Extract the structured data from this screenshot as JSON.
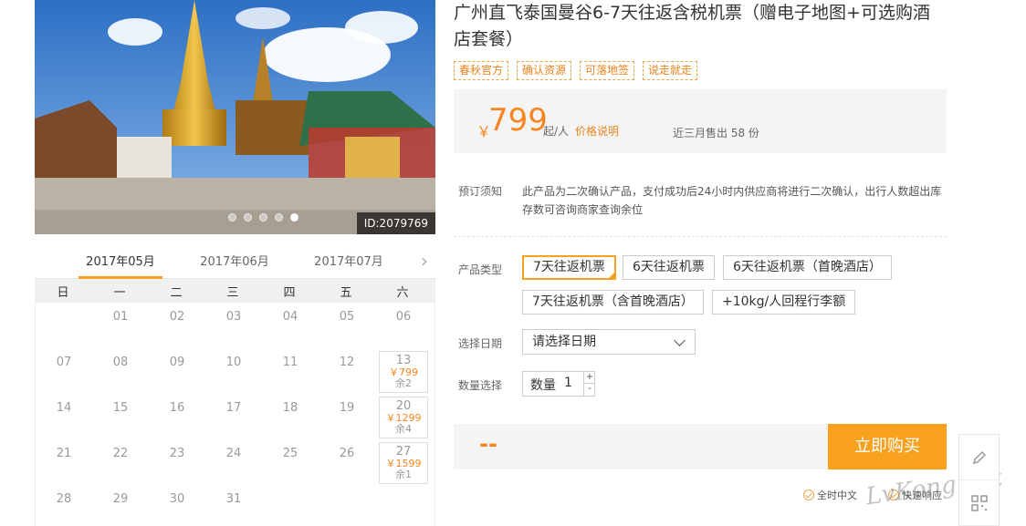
{
  "photo": {
    "id_label": "ID:2079769",
    "slides": 5,
    "active_slide": 5
  },
  "calendar": {
    "months": [
      "2017年05月",
      "2017年06月",
      "2017年07月"
    ],
    "active_month": 0,
    "weekdays": [
      "日",
      "一",
      "二",
      "三",
      "四",
      "五",
      "六"
    ],
    "leading_blanks": 1,
    "days": [
      "01",
      "02",
      "03",
      "04",
      "05",
      "06",
      "07",
      "08",
      "09",
      "10",
      "11",
      "12",
      "13",
      "14",
      "15",
      "16",
      "17",
      "18",
      "19",
      "20",
      "21",
      "22",
      "23",
      "24",
      "25",
      "26",
      "27",
      "28",
      "29",
      "30",
      "31"
    ],
    "available": {
      "13": {
        "price": "￥799",
        "left": "余2"
      },
      "20": {
        "price": "￥1299",
        "left": "余4"
      },
      "27": {
        "price": "￥1599",
        "left": "余1"
      }
    }
  },
  "product": {
    "title": "广州直飞泰国曼谷6-7天往返含税机票（赠电子地图+可选购酒店套餐）",
    "tags": [
      "春秋官方",
      "确认资源",
      "可落地签",
      "说走就走"
    ],
    "price": {
      "currency": "￥",
      "amount": "799",
      "unit": "起/人",
      "explain": "价格说明",
      "sold": "近三月售出 58 份"
    },
    "notice_label": "预订须知",
    "notice_text": "此产品为二次确认产品，支付成功后24小时内供应商将进行二次确认，出行人数超出库存数可咨询商家查询余位",
    "type_label": "产品类型",
    "types": [
      "7天往返机票",
      "6天往返机票",
      "6天往返机票（首晚酒店）",
      "7天往返机票（含首晚酒店）",
      "+10kg/人回程行李额"
    ],
    "selected_type": 0,
    "date_label": "选择日期",
    "date_placeholder": "请选择日期",
    "qty_label": "数量选择",
    "qty_prefix": "数量",
    "qty_value": "1",
    "qty_plus": "+",
    "qty_minus": "-",
    "total": "--",
    "buy_label": "立即购买",
    "guarantees": [
      "全时中文",
      "快速响应"
    ]
  },
  "watermark": "LvKong.net",
  "colors": {
    "accent": "#f7a11f",
    "price": "#f7851f"
  }
}
